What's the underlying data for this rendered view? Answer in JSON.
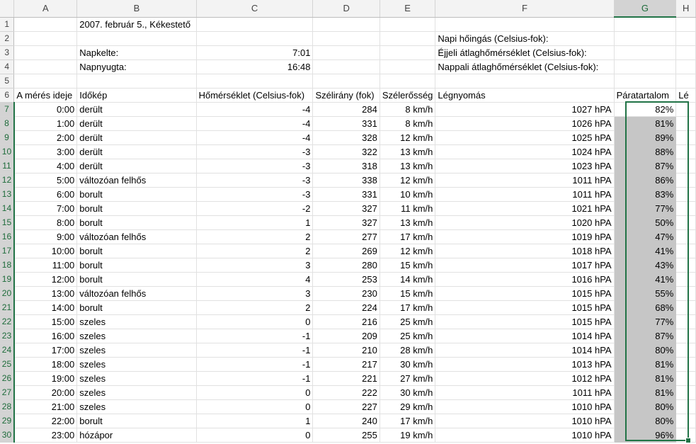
{
  "columns": [
    "A",
    "B",
    "C",
    "D",
    "E",
    "F",
    "G",
    "H"
  ],
  "info": {
    "b1": "2007. február 5., Kékestető",
    "b3": "Napkelte:",
    "c3": "7:01",
    "b4": "Napnyugta:",
    "c4": "16:48",
    "f2": "Napi hőingás (Celsius-fok):",
    "f3": "Éjjeli átlaghőmérséklet (Celsius-fok):",
    "f4": "Nappali átlaghőmérséklet (Celsius-fok):"
  },
  "headers": {
    "a": "A mérés ideje",
    "b": "Időkép",
    "c": "Hőmérséklet (Celsius-fok)",
    "d": "Szélirány (fok)",
    "e": "Szélerősség",
    "f": "Légnyomás",
    "g": "Páratartalom",
    "h": "Lé"
  },
  "rows": [
    {
      "time": "0:00",
      "sky": "derült",
      "temp": "-4",
      "dir": "284",
      "wind": "8 km/h",
      "press": "1027 hPA",
      "hum": "82%"
    },
    {
      "time": "1:00",
      "sky": "derült",
      "temp": "-4",
      "dir": "331",
      "wind": "8 km/h",
      "press": "1026 hPA",
      "hum": "81%"
    },
    {
      "time": "2:00",
      "sky": "derült",
      "temp": "-4",
      "dir": "328",
      "wind": "12 km/h",
      "press": "1025 hPA",
      "hum": "89%"
    },
    {
      "time": "3:00",
      "sky": "derült",
      "temp": "-3",
      "dir": "322",
      "wind": "13 km/h",
      "press": "1024 hPA",
      "hum": "88%"
    },
    {
      "time": "4:00",
      "sky": "derült",
      "temp": "-3",
      "dir": "318",
      "wind": "13 km/h",
      "press": "1023 hPA",
      "hum": "87%"
    },
    {
      "time": "5:00",
      "sky": "változóan felhős",
      "temp": "-3",
      "dir": "338",
      "wind": "12 km/h",
      "press": "1011 hPA",
      "hum": "86%"
    },
    {
      "time": "6:00",
      "sky": "borult",
      "temp": "-3",
      "dir": "331",
      "wind": "10 km/h",
      "press": "1011 hPA",
      "hum": "83%"
    },
    {
      "time": "7:00",
      "sky": "borult",
      "temp": "-2",
      "dir": "327",
      "wind": "11 km/h",
      "press": "1021 hPA",
      "hum": "77%"
    },
    {
      "time": "8:00",
      "sky": "borult",
      "temp": "1",
      "dir": "327",
      "wind": "13 km/h",
      "press": "1020 hPA",
      "hum": "50%"
    },
    {
      "time": "9:00",
      "sky": "változóan felhős",
      "temp": "2",
      "dir": "277",
      "wind": "17 km/h",
      "press": "1019 hPA",
      "hum": "47%"
    },
    {
      "time": "10:00",
      "sky": "borult",
      "temp": "2",
      "dir": "269",
      "wind": "12 km/h",
      "press": "1018 hPA",
      "hum": "41%"
    },
    {
      "time": "11:00",
      "sky": "borult",
      "temp": "3",
      "dir": "280",
      "wind": "15 km/h",
      "press": "1017 hPA",
      "hum": "43%"
    },
    {
      "time": "12:00",
      "sky": "borult",
      "temp": "4",
      "dir": "253",
      "wind": "14 km/h",
      "press": "1016 hPA",
      "hum": "41%"
    },
    {
      "time": "13:00",
      "sky": "változóan felhős",
      "temp": "3",
      "dir": "230",
      "wind": "15 km/h",
      "press": "1015 hPA",
      "hum": "55%"
    },
    {
      "time": "14:00",
      "sky": "borult",
      "temp": "2",
      "dir": "224",
      "wind": "17 km/h",
      "press": "1015 hPA",
      "hum": "68%"
    },
    {
      "time": "15:00",
      "sky": "szeles",
      "temp": "0",
      "dir": "216",
      "wind": "25 km/h",
      "press": "1015 hPA",
      "hum": "77%"
    },
    {
      "time": "16:00",
      "sky": "szeles",
      "temp": "-1",
      "dir": "209",
      "wind": "25 km/h",
      "press": "1014 hPA",
      "hum": "87%"
    },
    {
      "time": "17:00",
      "sky": "szeles",
      "temp": "-1",
      "dir": "210",
      "wind": "28 km/h",
      "press": "1014 hPA",
      "hum": "80%"
    },
    {
      "time": "18:00",
      "sky": "szeles",
      "temp": "-1",
      "dir": "217",
      "wind": "30 km/h",
      "press": "1013 hPA",
      "hum": "81%"
    },
    {
      "time": "19:00",
      "sky": "szeles",
      "temp": "-1",
      "dir": "221",
      "wind": "27 km/h",
      "press": "1012 hPA",
      "hum": "81%"
    },
    {
      "time": "20:00",
      "sky": "szeles",
      "temp": "0",
      "dir": "222",
      "wind": "30 km/h",
      "press": "1011 hPA",
      "hum": "81%"
    },
    {
      "time": "21:00",
      "sky": "szeles",
      "temp": "0",
      "dir": "227",
      "wind": "29 km/h",
      "press": "1010 hPA",
      "hum": "80%"
    },
    {
      "time": "22:00",
      "sky": "borult",
      "temp": "1",
      "dir": "240",
      "wind": "17 km/h",
      "press": "1010 hPA",
      "hum": "80%"
    },
    {
      "time": "23:00",
      "sky": "hózápor",
      "temp": "0",
      "dir": "255",
      "wind": "19 km/h",
      "press": "1010 hPA",
      "hum": "96%"
    }
  ],
  "colors": {
    "selection_accent": "#217346",
    "selection_fill": "#c6c6c6",
    "header_fill": "#f3f3f3"
  }
}
